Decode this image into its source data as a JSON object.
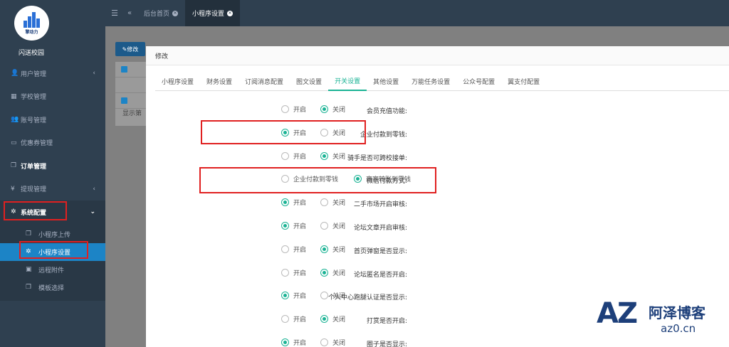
{
  "app": {
    "logo_text": "擎动力",
    "school_name": "闪送校园"
  },
  "sidebar": {
    "items": [
      {
        "label": "用户管理",
        "icon": "user-icon",
        "arrow": "‹"
      },
      {
        "label": "学校管理",
        "icon": "building-icon",
        "arrow": ""
      },
      {
        "label": "账号管理",
        "icon": "users-icon",
        "arrow": ""
      },
      {
        "label": "优惠券管理",
        "icon": "coupon-icon",
        "arrow": ""
      },
      {
        "label": "订单管理",
        "icon": "copy-icon",
        "arrow": ""
      },
      {
        "label": "提现管理",
        "icon": "yen-icon",
        "arrow": "‹"
      },
      {
        "label": "系统配置",
        "icon": "gear-icon",
        "arrow": "⌄"
      }
    ],
    "sub_items": [
      {
        "label": "小程序上传",
        "icon": "copy-icon"
      },
      {
        "label": "小程序设置",
        "icon": "gear-icon"
      },
      {
        "label": "远程附件",
        "icon": "image-icon"
      },
      {
        "label": "模板选择",
        "icon": "copy-icon"
      }
    ]
  },
  "topbar": {
    "tabs": [
      {
        "label": "后台首页"
      },
      {
        "label": "小程序设置"
      }
    ]
  },
  "background": {
    "edit_label": "修改",
    "show_text": "显示第"
  },
  "modal": {
    "title": "修改",
    "tabs": [
      "小程序设置",
      "财务设置",
      "订阅消息配置",
      "图文设置",
      "开关设置",
      "其他设置",
      "万能任务设置",
      "公众号配置",
      "翼支付配置"
    ],
    "active_tab": 4,
    "rows": [
      {
        "label": "会员充值功能:",
        "options": [
          "开启",
          "关闭"
        ],
        "selected": 1
      },
      {
        "label": "企业付款到零钱:",
        "options": [
          "开启",
          "关闭"
        ],
        "selected": 0
      },
      {
        "label": "骑手是否可跨校接单:",
        "options": [
          "开启",
          "关闭"
        ],
        "selected": 1
      },
      {
        "label": "微信付款方式:",
        "options": [
          "企业付款到零钱",
          "商家转账到零钱"
        ],
        "selected": 1
      },
      {
        "label": "二手市场开启审核:",
        "options": [
          "开启",
          "关闭"
        ],
        "selected": 0
      },
      {
        "label": "论坛文章开启审核:",
        "options": [
          "开启",
          "关闭"
        ],
        "selected": 0
      },
      {
        "label": "首页弹窗是否显示:",
        "options": [
          "开启",
          "关闭"
        ],
        "selected": 1
      },
      {
        "label": "论坛匿名是否开启:",
        "options": [
          "开启",
          "关闭"
        ],
        "selected": 1
      },
      {
        "label": "个人中心跑腿认证是否显示:",
        "options": [
          "开启",
          "关闭"
        ],
        "selected": 0
      },
      {
        "label": "打赏是否开启:",
        "options": [
          "开启",
          "关闭"
        ],
        "selected": 1
      },
      {
        "label": "圈子是否显示:",
        "options": [
          "开启",
          "关闭"
        ],
        "selected": 0
      }
    ]
  },
  "watermark": {
    "logo": "AZ",
    "name": "阿泽博客",
    "url": "az0.cn"
  },
  "colors": {
    "sidebar_bg": "#2f4050",
    "accent_green": "#1ab394",
    "active_blue": "#1c84c6",
    "highlight_red": "#e02020"
  }
}
